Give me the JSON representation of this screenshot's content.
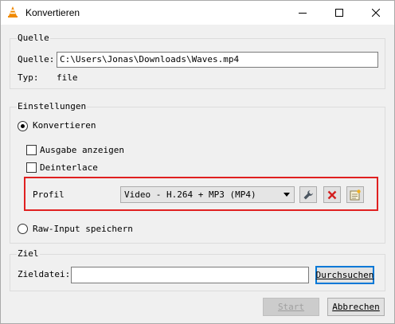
{
  "window": {
    "title": "Konvertieren"
  },
  "source": {
    "group_label": "Quelle",
    "source_label": "Quelle:",
    "source_value": "C:\\Users\\Jonas\\Downloads\\Waves.mp4",
    "type_label": "Typ:",
    "type_value": "file"
  },
  "settings": {
    "group_label": "Einstellungen",
    "convert_label": "Konvertieren",
    "convert_selected": true,
    "show_output_label": "Ausgabe anzeigen",
    "show_output_checked": false,
    "deinterlace_label": "Deinterlace",
    "deinterlace_checked": false,
    "profile_label": "Profil",
    "profile_selected": "Video - H.264 + MP3 (MP4)",
    "raw_input_label": "Raw-Input speichern",
    "raw_input_selected": false
  },
  "target": {
    "group_label": "Ziel",
    "file_label": "Zieldatei:",
    "file_value": "",
    "browse_label": "Durchsuchen"
  },
  "buttons": {
    "start_label": "Start",
    "cancel_label": "Abbrechen"
  },
  "colors": {
    "highlight_border": "#e02020",
    "delete_icon": "#d32020",
    "default_button_border": "#0078d7"
  }
}
